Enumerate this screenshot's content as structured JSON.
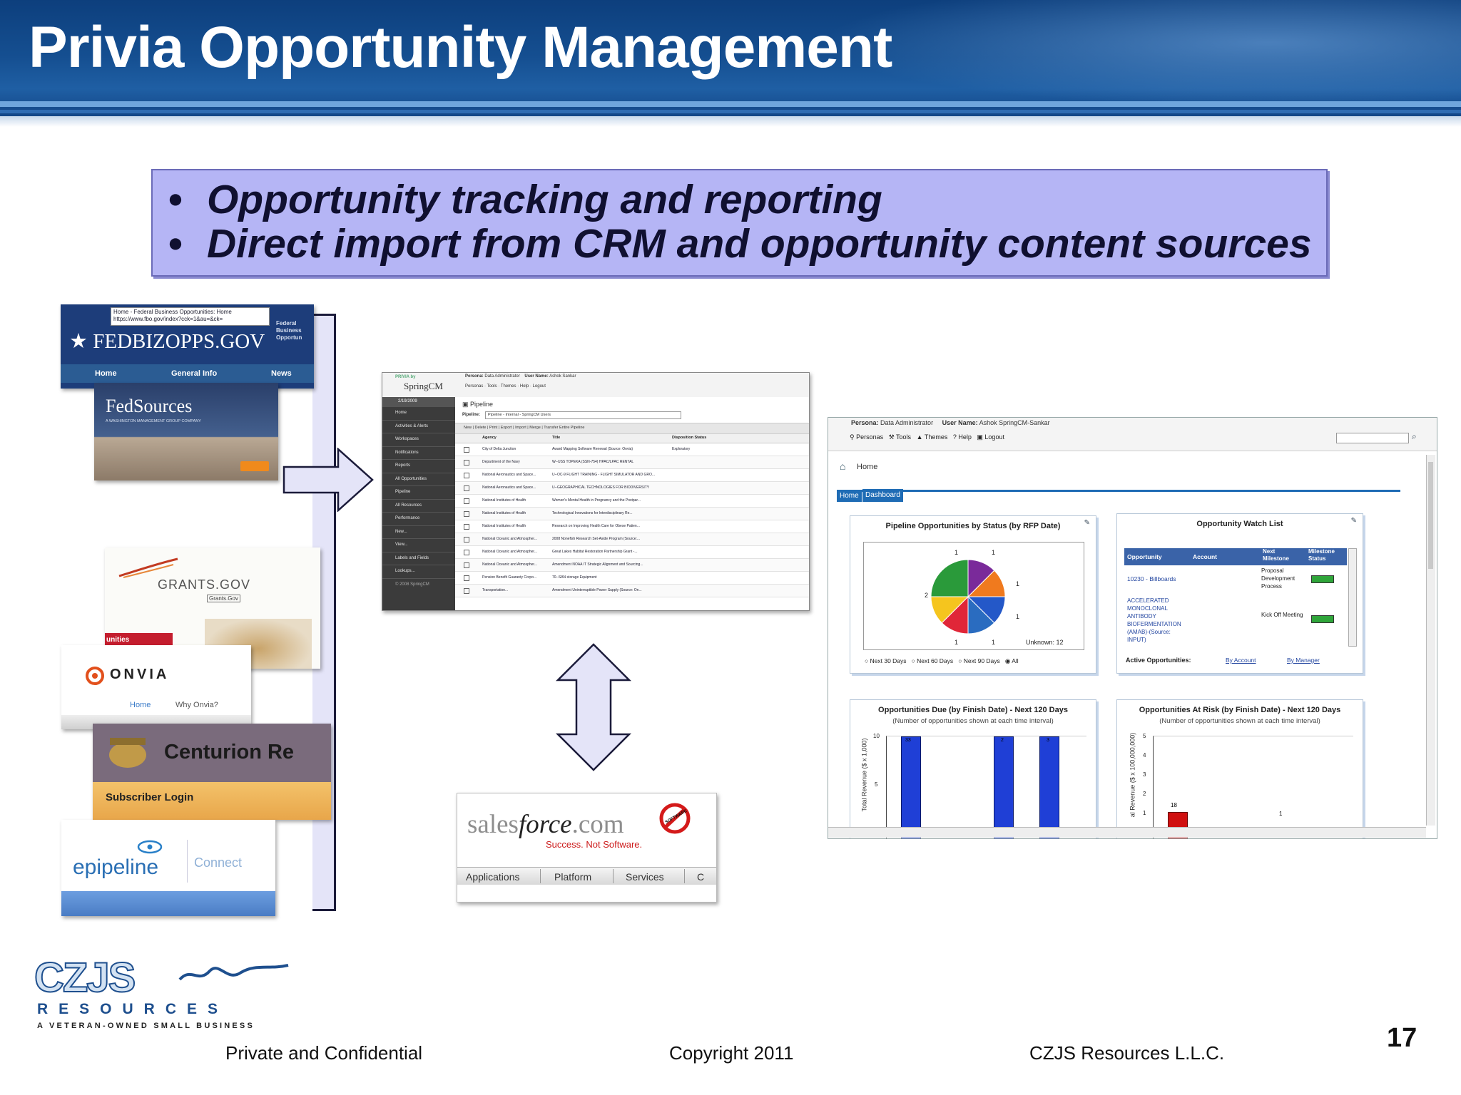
{
  "slide": {
    "title": "Privia Opportunity Management",
    "bullets": [
      "Opportunity tracking and reporting",
      "Direct import from CRM and opportunity content sources"
    ],
    "page_number": "17"
  },
  "sources": {
    "fedbizopps": {
      "browser_title": "Home - Federal Business Opportunities: Home",
      "url": "https://www.fbo.gov/index?cck=1&au=&ck=",
      "logo": "★ FEDBIZOPPS.GOV",
      "side_text": [
        "Federal",
        "Business",
        "Opportun"
      ],
      "nav": [
        "Home",
        "General Info",
        "News"
      ]
    },
    "fedsources": {
      "logo": "FedSources",
      "tagline": "A WASHINGTON MANAGEMENT GROUP COMPANY"
    },
    "grants": {
      "logo": "GRANTS.GOV",
      "link": "Grants.Gov",
      "side_text": "unities"
    },
    "onvia": {
      "logo": "ONVIA",
      "nav": [
        "Home",
        "Why Onvia?"
      ]
    },
    "centurion": {
      "logo": "Centurion Re",
      "login": "Subscriber Login"
    },
    "epipeline": {
      "logo": "epipeline",
      "connect": "Connect"
    }
  },
  "springcm": {
    "brand_top": "PRIVIA by",
    "brand": "SpringCM",
    "date": "2/19/2009",
    "persona_label": "Persona:",
    "persona_value": "Data Administrator",
    "user_label": "User Name:",
    "user_value": "Ashok Sankar",
    "top_menu": [
      "Personas",
      "Tools",
      "Themes",
      "Help",
      "Logout"
    ],
    "page_title": "Pipeline",
    "pipeline_label": "Pipeline:",
    "pipeline_value": "Pipeline - Internal - SpringCM Users",
    "toolbar": [
      "New",
      "Delete",
      "Print",
      "Export",
      "Import",
      "Merge",
      "Transfer Entire Pipeline"
    ],
    "sidebar_items": [
      "Home",
      "Activities & Alerts",
      "Workspaces",
      "Notifications",
      "Reports",
      "All Opportunities",
      "Pipeline",
      "All Resources",
      "Performance",
      "New...",
      "View...",
      "Labels and Fields",
      "Lookups..."
    ],
    "copyright": "© 2008 SpringCM",
    "columns": [
      "Agency",
      "Title",
      "Disposition Status"
    ],
    "rows": [
      [
        "City of Delta Junction",
        "Award Mapping Software Renewal (Source: Onvia)",
        "Exploratory"
      ],
      [
        "Department of the Navy",
        "W--USS TOPEKA (SSN-754) HPAC/LPAC RENTAL",
        ""
      ],
      [
        "National Aeronautics and Space...",
        "U--OC-9 FLIGHT TRAINING - FLIGHT SIMULATOR AND GRO...",
        ""
      ],
      [
        "National Aeronautics and Space...",
        "U--GEOGRAPHICAL TECHNOLOGIES FOR BIODIVERSITY",
        ""
      ],
      [
        "National Institutes of Health",
        "Women's Mental Health in Pregnancy and the Postpar...",
        ""
      ],
      [
        "National Institutes of Health",
        "Technological Innovations for Interdisciplinary Re...",
        ""
      ],
      [
        "National Institutes of Health",
        "Research on Improving Health Care for Obese Patien...",
        ""
      ],
      [
        "National Oceanic and Atmospher...",
        "2008 Nonefish Research Set-Aside Program (Source:...",
        ""
      ],
      [
        "National Oceanic and Atmospher...",
        "Great Lakes Habitat Restoration Partnership Grant -...",
        ""
      ],
      [
        "National Oceanic and Atmospher...",
        "Amendment NOAA IT Strategic Alignment and Sourcing...",
        ""
      ],
      [
        "Pension Benefit Guaranty Corpo...",
        "70--SAN storage Equipment",
        ""
      ],
      [
        "Transportation...",
        "Amendment Uninterruptible Power Supply (Source: On...",
        ""
      ]
    ]
  },
  "salesforce": {
    "logo_a": "sales",
    "logo_b": "force",
    "logo_c": ".com",
    "tagline": "Success. Not Software.",
    "badge": "SOFTWARE",
    "nav": [
      "Applications",
      "Platform",
      "Services",
      "C"
    ]
  },
  "dashboard": {
    "persona_label": "Persona:",
    "persona_value": "Data Administrator",
    "user_label": "User Name:",
    "user_value": "Ashok SpringCM-Sankar",
    "menu": [
      "Personas",
      "Tools",
      "Themes",
      "Help",
      "Logout"
    ],
    "home_label": "Home",
    "tabs": [
      "Home",
      "Dashboard"
    ],
    "pie_panel": {
      "title": "Pipeline Opportunities by Status (by RFP Date)",
      "labels": [
        "1",
        "1",
        "1",
        "1",
        "1",
        "1",
        "2"
      ],
      "unknown": "Unknown: 12",
      "radios": [
        "Next 30 Days",
        "Next 60 Days",
        "Next 90 Days",
        "All"
      ],
      "selected": "All"
    },
    "watch_panel": {
      "title": "Opportunity Watch List",
      "columns": [
        "Opportunity",
        "Account",
        "Next Milestone",
        "Milestone Status"
      ],
      "rows": [
        {
          "opportunity": "10230 - Billboards",
          "account": "",
          "milestone": "Proposal Development Process"
        },
        {
          "opportunity": "ACCELERATED MONOCLONAL ANTIBODY BIOFERMENTATION (AMAB)-(Source: INPUT)",
          "account": "",
          "milestone": "Kick Off Meeting"
        }
      ],
      "active_label": "Active Opportunities:",
      "by_account": "By Account",
      "by_manager": "By Manager"
    },
    "due_panel": {
      "title": "Opportunities Due (by Finish Date) - Next 120 Days",
      "subtitle": "(Number of opportunities shown at each time interval)",
      "ylabel": "Total Revenue ($ x 1,000)",
      "ticks": [
        "10",
        "5"
      ],
      "bar_labels": [
        "33",
        "2",
        "3"
      ]
    },
    "risk_panel": {
      "title": "Opportunities At Risk (by Finish Date) - Next 120 Days",
      "subtitle": "(Number of opportunities shown at each time interval)",
      "ylabel": "al Revenue ($ x 100,000,000)",
      "ticks": [
        "5",
        "4",
        "3",
        "2",
        "1"
      ],
      "bar_labels": [
        "18",
        "1"
      ]
    }
  },
  "czjs": {
    "logo": "CZJS",
    "resources": "RESOURCES",
    "tagline": "A VETERAN-OWNED SMALL BUSINESS"
  },
  "footer": {
    "left": "Private and Confidential",
    "center": "Copyright 2011",
    "right": "CZJS Resources L.L.C."
  },
  "colors": {
    "header_blue": "#154f91",
    "bullet_box": "#b5b5f5",
    "arrow_fill": "#e4e4f8",
    "dash_tab": "#1f6cb5",
    "bar_blue": "#1f3fd6",
    "bar_red": "#d01010"
  }
}
